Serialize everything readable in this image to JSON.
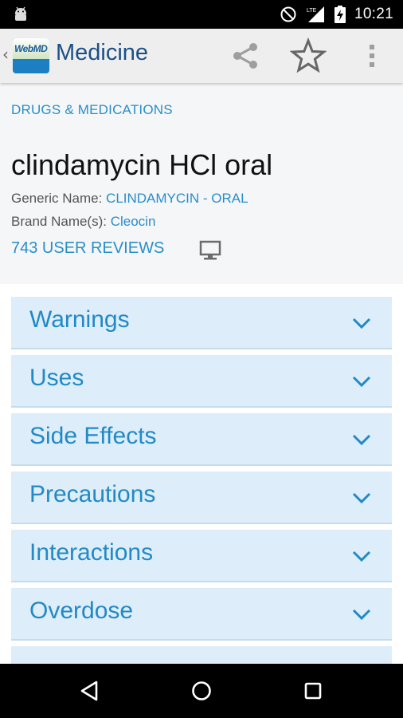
{
  "status_bar": {
    "time": "10:21",
    "network_label": "LTE",
    "icons": [
      "android-icon",
      "do-not-disturb-icon",
      "lte-signal-icon",
      "battery-charging-icon"
    ]
  },
  "action_bar": {
    "logo_text": "WebMD",
    "title": "Medicine",
    "icons": [
      "share-icon",
      "star-icon",
      "overflow-menu-icon"
    ]
  },
  "header": {
    "breadcrumb": "DRUGS & MEDICATIONS",
    "drug_title": "clindamycin HCl oral",
    "generic_label": "Generic Name: ",
    "generic_value": "CLINDAMYCIN - ORAL",
    "brand_label": "Brand Name(s): ",
    "brand_value": "Cleocin",
    "reviews": "743 USER REVIEWS"
  },
  "sections": [
    {
      "label": "Warnings"
    },
    {
      "label": "Uses"
    },
    {
      "label": "Side Effects"
    },
    {
      "label": "Precautions"
    },
    {
      "label": "Interactions"
    },
    {
      "label": "Overdose"
    }
  ],
  "colors": {
    "accent_blue": "#2289c6",
    "section_bg": "#ddeefa",
    "title_blue": "#1c4f86"
  },
  "nav_bar": {
    "icons": [
      "back-icon",
      "home-icon",
      "recents-icon"
    ]
  }
}
